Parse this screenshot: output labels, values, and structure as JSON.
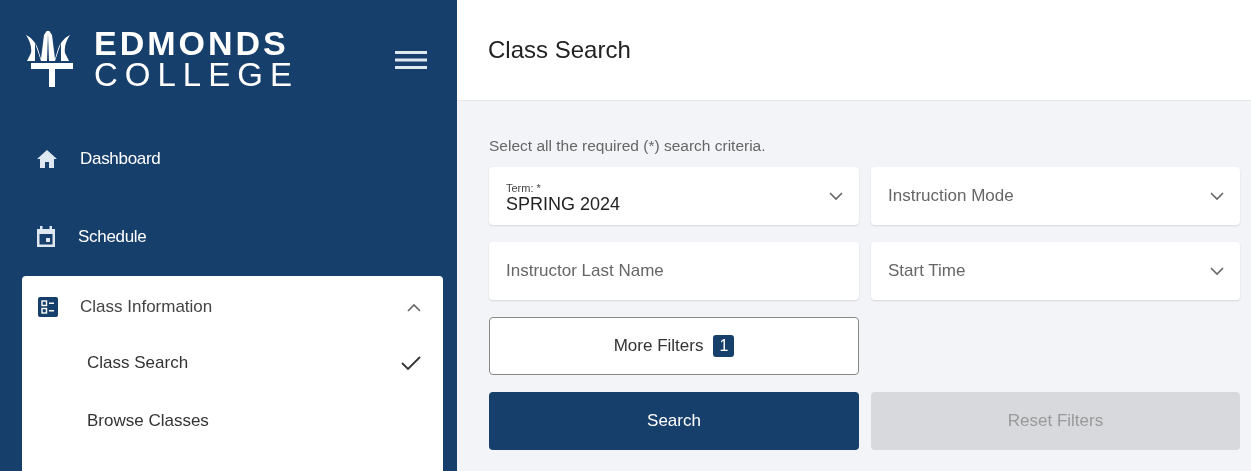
{
  "sidebar": {
    "logo": {
      "line1": "EDMONDS",
      "line2": "COLLEGE"
    },
    "items": [
      {
        "label": "Dashboard",
        "kind": "link"
      },
      {
        "label": "Schedule",
        "kind": "link"
      },
      {
        "label": "Class Information",
        "kind": "group",
        "expanded": true,
        "children": [
          {
            "label": "Class Search",
            "selected": true
          },
          {
            "label": "Browse Classes",
            "selected": false
          }
        ]
      }
    ]
  },
  "page": {
    "title": "Class Search"
  },
  "form": {
    "instructions": "Select all the required (*) search criteria.",
    "fields": [
      {
        "kind": "select",
        "label": "Term: *",
        "value": "SPRING 2024"
      },
      {
        "kind": "select",
        "placeholder": "Instruction Mode"
      },
      {
        "kind": "text",
        "placeholder": "Instructor Last Name"
      },
      {
        "kind": "select",
        "placeholder": "Start Time"
      }
    ],
    "more_filters": {
      "label": "More Filters",
      "count": "1"
    },
    "buttons": [
      {
        "label": "Search",
        "disabled": false
      },
      {
        "label": "Reset Filters",
        "disabled": true
      }
    ]
  }
}
